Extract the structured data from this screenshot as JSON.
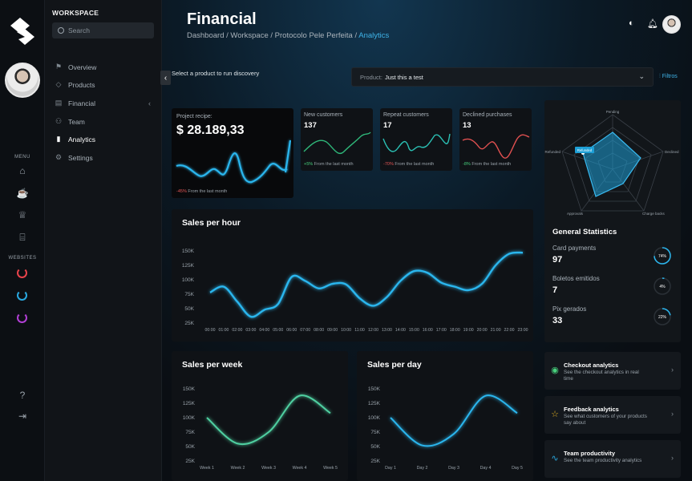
{
  "workspace": {
    "title": "WORKSPACE",
    "search_placeholder": "Search"
  },
  "sidebar": {
    "items": [
      {
        "label": "Overview",
        "icon": "flag-icon"
      },
      {
        "label": "Products",
        "icon": "tag-icon"
      },
      {
        "label": "Financial",
        "icon": "money-icon"
      },
      {
        "label": "Team",
        "icon": "team-icon"
      },
      {
        "label": "Analytics",
        "icon": "bar-chart-icon"
      },
      {
        "label": "Settings",
        "icon": "gear-icon"
      }
    ],
    "active": "Analytics"
  },
  "rail": {
    "menu_label": "MENU",
    "websites_label": "WEBSITES",
    "website_colors": [
      "#e8434b",
      "#29a8e0",
      "#b13fd4"
    ]
  },
  "header": {
    "title": "Financial",
    "breadcrumb": [
      "Dashboard",
      "Workspace",
      "Protocolo Pele Perfeita"
    ],
    "breadcrumb_current": "Analytics"
  },
  "product_prompt": "Select a product to run discovery",
  "product_select": {
    "label": "Product:",
    "value": "Just this a test"
  },
  "filters_label": "Filtros",
  "kpis": {
    "project": {
      "label": "Project recipe:",
      "value": "$ 28.189,33",
      "delta": "-45%",
      "foot": "From the last month"
    },
    "new_customers": {
      "label": "New customers",
      "value": "137",
      "delta": "+5%",
      "foot": "From the last month"
    },
    "repeat_customers": {
      "label": "Repeat customers",
      "value": "17",
      "delta": "-70%",
      "foot": "From the last month"
    },
    "declined": {
      "label": "Declined purchases",
      "value": "13",
      "delta": "-8%",
      "foot": "From the last month"
    }
  },
  "radar": {
    "axes": [
      "Pending",
      "Declined",
      "Charge backs",
      "Approvals",
      "Refunded"
    ],
    "highlight": "Refunded"
  },
  "general_stats": {
    "title": "General Statistics",
    "items": [
      {
        "label": "Card payments",
        "value": "97",
        "percent": 74,
        "percent_label": "74%"
      },
      {
        "label": "Boletos emitidos",
        "value": "7",
        "percent": 4,
        "percent_label": "4%"
      },
      {
        "label": "Pix gerados",
        "value": "33",
        "percent": 22,
        "percent_label": "22%"
      }
    ]
  },
  "quick_actions": [
    {
      "title": "Checkout analytics",
      "subtitle": "See the checkout analytics in real time",
      "icon": "signal-icon",
      "color": "#48d17d"
    },
    {
      "title": "Feedback analytics",
      "subtitle": "See what customers of your products say about",
      "icon": "star-icon",
      "color": "#e6b422"
    },
    {
      "title": "Team productivity",
      "subtitle": "See the team productivity analytics",
      "icon": "pulse-icon",
      "color": "#29a8e0"
    }
  ],
  "chart_data": [
    {
      "type": "line",
      "title": "Sales per hour",
      "x": [
        "00:00",
        "01:00",
        "02:00",
        "03:00",
        "04:00",
        "05:00",
        "06:00",
        "07:00",
        "08:00",
        "09:00",
        "10:00",
        "11:00",
        "12:00",
        "13:00",
        "14:00",
        "15:00",
        "16:00",
        "17:00",
        "18:00",
        "19:00",
        "20:00",
        "21:00",
        "22:00",
        "23:00"
      ],
      "y_ticks": [
        "150K",
        "125K",
        "100K",
        "75K",
        "50K",
        "25K"
      ],
      "ylim": [
        25000,
        150000
      ],
      "values": [
        78000,
        88000,
        62000,
        36000,
        48000,
        58000,
        105000,
        98000,
        85000,
        93000,
        92000,
        68000,
        55000,
        70000,
        98000,
        115000,
        112000,
        95000,
        88000,
        82000,
        93000,
        125000,
        145000,
        147000
      ],
      "color": "#2bb6ee"
    },
    {
      "type": "line",
      "title": "Sales per week",
      "x": [
        "Week 1",
        "Week 2",
        "Week 3",
        "Week 4",
        "Week 5"
      ],
      "y_ticks": [
        "150K",
        "125K",
        "100K",
        "75K",
        "50K",
        "25K"
      ],
      "ylim": [
        25000,
        150000
      ],
      "values": [
        100000,
        55000,
        75000,
        138000,
        108000
      ],
      "color": "#4fd0a1"
    },
    {
      "type": "line",
      "title": "Sales per day",
      "x": [
        "Day 1",
        "Day 2",
        "Day 3",
        "Day 4",
        "Day 5"
      ],
      "y_ticks": [
        "150K",
        "125K",
        "100K",
        "75K",
        "50K",
        "25K"
      ],
      "ylim": [
        25000,
        150000
      ],
      "values": [
        100000,
        52000,
        72000,
        138000,
        108000
      ],
      "color": "#2bb6ee"
    }
  ]
}
